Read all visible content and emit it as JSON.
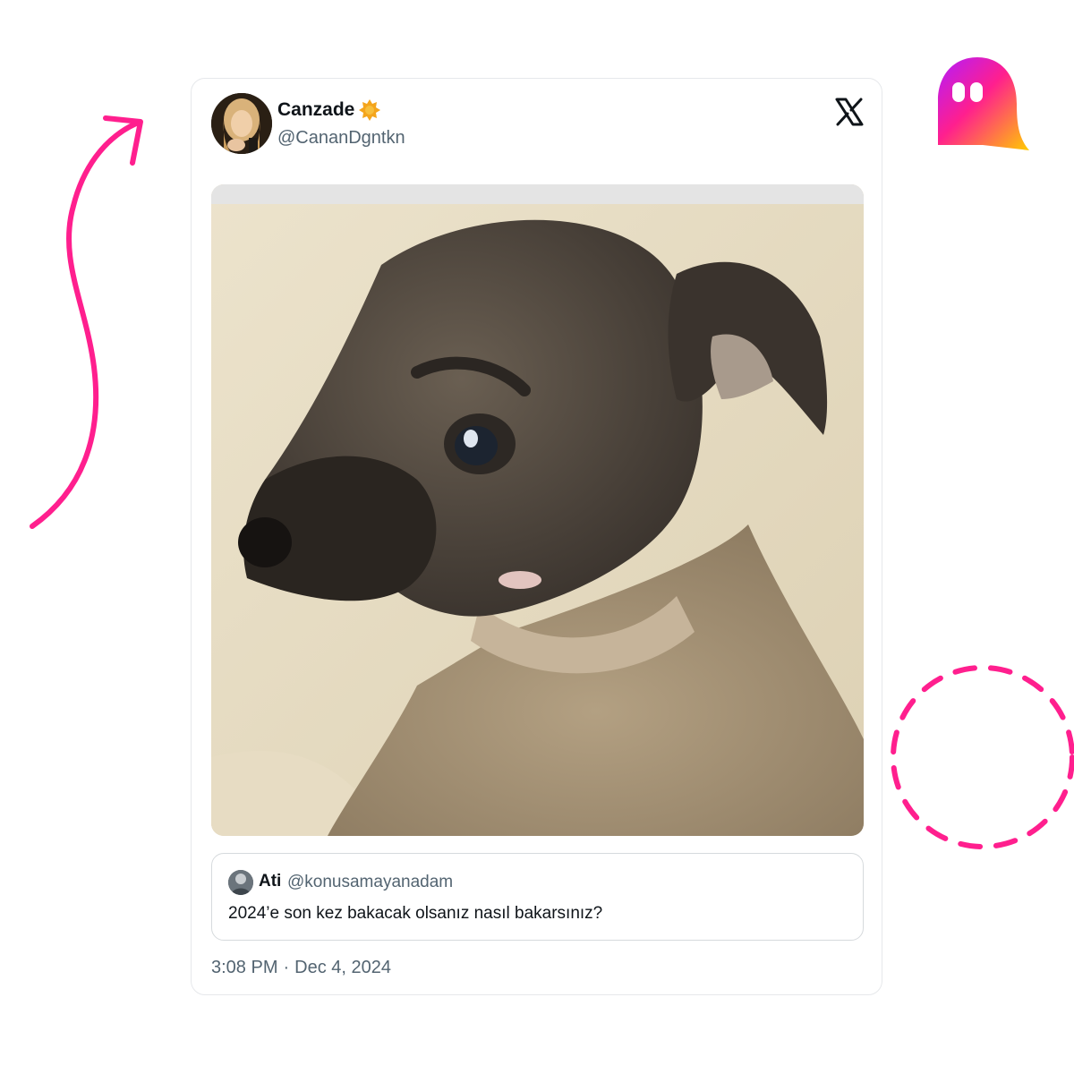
{
  "colors": {
    "accent_pink": "#ff1f8e",
    "verified_gold": "#f4a51c",
    "text_primary": "#0f1419",
    "text_secondary": "#536471",
    "card_border": "#e6e8eb"
  },
  "tweet": {
    "author": {
      "display_name": "Canzade",
      "handle": "@CananDgntkn",
      "badge_icon": "verified-badge-icon",
      "avatar_icon": "profile-photo"
    },
    "platform_icon": "x-logo-icon",
    "media_description_icon": "dog-photo",
    "quoted": {
      "display_name": "Ati",
      "handle": "@konusamayanadam",
      "text": "2024’e son kez bakacak olsanız nasıl bakarsınız?"
    },
    "time": "3:08 PM",
    "separator": "·",
    "date": "Dec 4, 2024"
  },
  "decorations": {
    "arrow_icon": "curved-arrow-icon",
    "circle_icon": "dashed-circle-icon",
    "brand_icon": "ghost-logo-icon"
  }
}
